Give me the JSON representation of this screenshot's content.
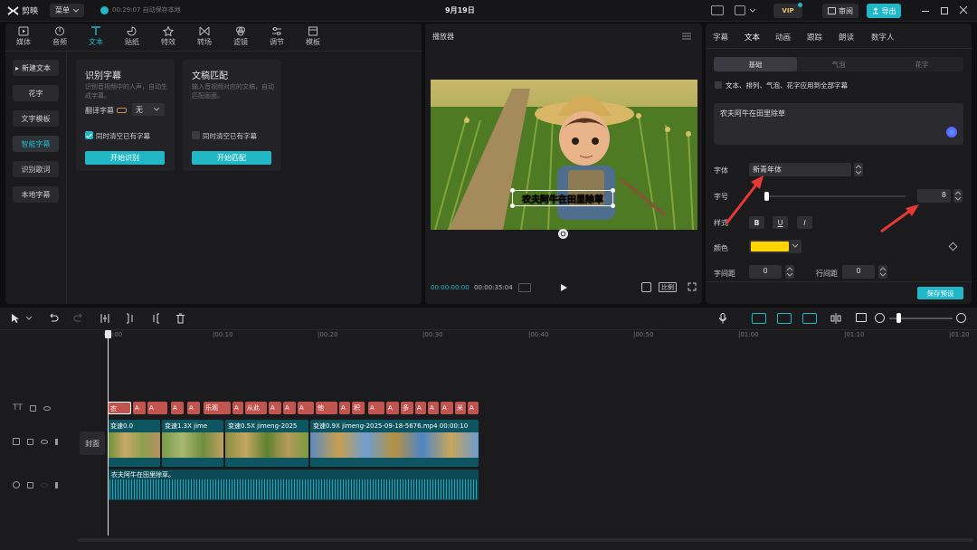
{
  "app": {
    "name": "剪映",
    "menu_label": "菜单",
    "autosave": "00:29:07 自动保存本地",
    "date": "9月19日",
    "vip": "VIP",
    "review_label": "审阅",
    "export_label": "导出"
  },
  "media_tabs": [
    {
      "label": "媒体",
      "icon": "media-icon"
    },
    {
      "label": "音频",
      "icon": "audio-icon"
    },
    {
      "label": "文本",
      "icon": "text-icon"
    },
    {
      "label": "贴纸",
      "icon": "sticker-icon"
    },
    {
      "label": "特效",
      "icon": "effects-icon"
    },
    {
      "label": "转场",
      "icon": "transition-icon"
    },
    {
      "label": "滤镜",
      "icon": "filter-icon"
    },
    {
      "label": "调节",
      "icon": "adjust-icon"
    },
    {
      "label": "模板",
      "icon": "template-icon"
    }
  ],
  "text_sidebar": [
    {
      "label": "新建文本",
      "bullet": "▸"
    },
    {
      "label": "花字"
    },
    {
      "label": "文字模板"
    },
    {
      "label": "智能字幕"
    },
    {
      "label": "识别歌词"
    },
    {
      "label": "本地字幕"
    }
  ],
  "cards": {
    "recognize": {
      "title": "识别字幕",
      "desc": "识别音视频中的人声，自动生成字幕。",
      "translate_label": "翻译字幕",
      "translate_value": "无",
      "clear_label": "同时清空已有字幕",
      "button": "开始识别"
    },
    "match": {
      "title": "文稿匹配",
      "desc": "输入音视频对应的文稿，自动匹配画面。",
      "clear_label": "同时清空已有字幕",
      "button": "开始匹配"
    }
  },
  "player": {
    "title": "播放器",
    "caption": "农夫阿牛在田里除草",
    "current_time": "00:00:00:00",
    "total_time": "00:00:35:04",
    "ratio_label": "比例"
  },
  "inspector": {
    "tabs": [
      "字幕",
      "文本",
      "动画",
      "跟踪",
      "朗读",
      "数字人"
    ],
    "sub_tabs": [
      "基础",
      "气泡",
      "花字"
    ],
    "apply_all": "文本、排列、气泡、花字应用到全部字幕",
    "text_value": "农夫阿牛在田里除草",
    "font_label": "字体",
    "font_value": "新青年体",
    "size_label": "字号",
    "size_value": "8",
    "style_label": "样式",
    "style_b": "B",
    "style_u": "U",
    "style_i": "I",
    "color_label": "颜色",
    "color_hex": "#ffd400",
    "char_spacing_label": "字间距",
    "char_spacing_value": "0",
    "line_spacing_label": "行间距",
    "line_spacing_value": "0",
    "save_preset": "保存预设"
  },
  "timeline": {
    "ruler": [
      "00:00",
      "|00:10",
      "|00:20",
      "|00:30",
      "|00:40",
      "|00:50",
      "|01:00",
      "|01:10",
      "|01:20"
    ],
    "cover_label": "封面",
    "subtitle_clips": [
      "农",
      "A",
      "A",
      "A",
      "A",
      "乐观",
      "A",
      "从此",
      "A",
      "A",
      "A",
      "他",
      "A",
      "积",
      "A",
      "A",
      "多",
      "A",
      "A",
      "A",
      "米",
      "A"
    ],
    "video_clips": [
      {
        "label": "变速0.0"
      },
      {
        "label": "变速1.3X  jime"
      },
      {
        "label": "变速0.5X  jimeng-2025"
      },
      {
        "label": "变速0.9X  jimeng-2025-09-18-5676.mp4  00:00:10"
      }
    ],
    "audio_label": "农夫阿牛在田里除草。"
  }
}
